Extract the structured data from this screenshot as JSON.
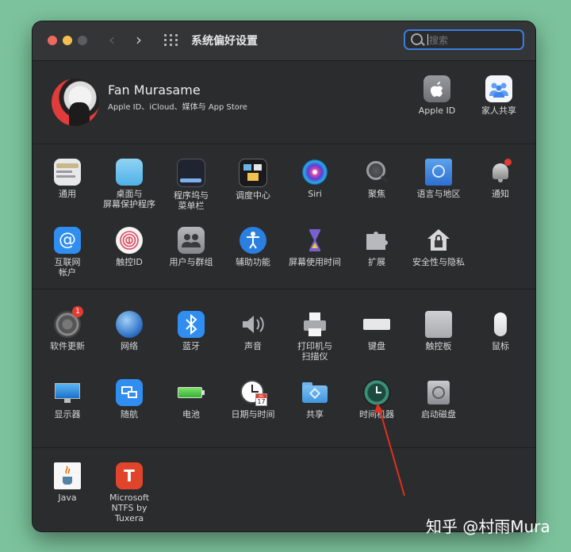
{
  "window": {
    "title": "系统偏好设置"
  },
  "search": {
    "placeholder": "搜索"
  },
  "profile": {
    "name": "Fan Murasame",
    "subtitle": "Apple ID、iCloud、媒体与 App Store",
    "apple_id_label": "Apple ID",
    "family_label": "家人共享"
  },
  "row1": [
    {
      "label": "通用"
    },
    {
      "label": "桌面与\n屏幕保护程序"
    },
    {
      "label": "程序坞与\n菜单栏"
    },
    {
      "label": "调度中心"
    },
    {
      "label": "Siri"
    },
    {
      "label": "聚焦"
    },
    {
      "label": "语言与地区"
    },
    {
      "label": "通知"
    }
  ],
  "row2": [
    {
      "label": "互联网\n帐户"
    },
    {
      "label": "触控ID"
    },
    {
      "label": "用户与群组"
    },
    {
      "label": "辅助功能"
    },
    {
      "label": "屏幕使用时间"
    },
    {
      "label": "扩展"
    },
    {
      "label": "安全性与隐私"
    }
  ],
  "row3": [
    {
      "label": "软件更新",
      "badge": "1"
    },
    {
      "label": "网络"
    },
    {
      "label": "蓝牙"
    },
    {
      "label": "声音"
    },
    {
      "label": "打印机与\n扫描仪"
    },
    {
      "label": "键盘"
    },
    {
      "label": "触控板"
    },
    {
      "label": "鼠标"
    }
  ],
  "row4": [
    {
      "label": "显示器"
    },
    {
      "label": "随航"
    },
    {
      "label": "电池"
    },
    {
      "label": "日期与时间",
      "calendar_month": "JUL",
      "calendar_day": "17"
    },
    {
      "label": "共享"
    },
    {
      "label": "时间机器"
    },
    {
      "label": "启动磁盘"
    }
  ],
  "row5": [
    {
      "label": "Java"
    },
    {
      "label": "Microsoft\nNTFS by Tuxera"
    }
  ],
  "watermark": "知乎 @村雨Mura",
  "colors": {
    "accent": "#3b7ddf",
    "annotation_arrow": "#e0301e",
    "background": "#7cc39d"
  }
}
